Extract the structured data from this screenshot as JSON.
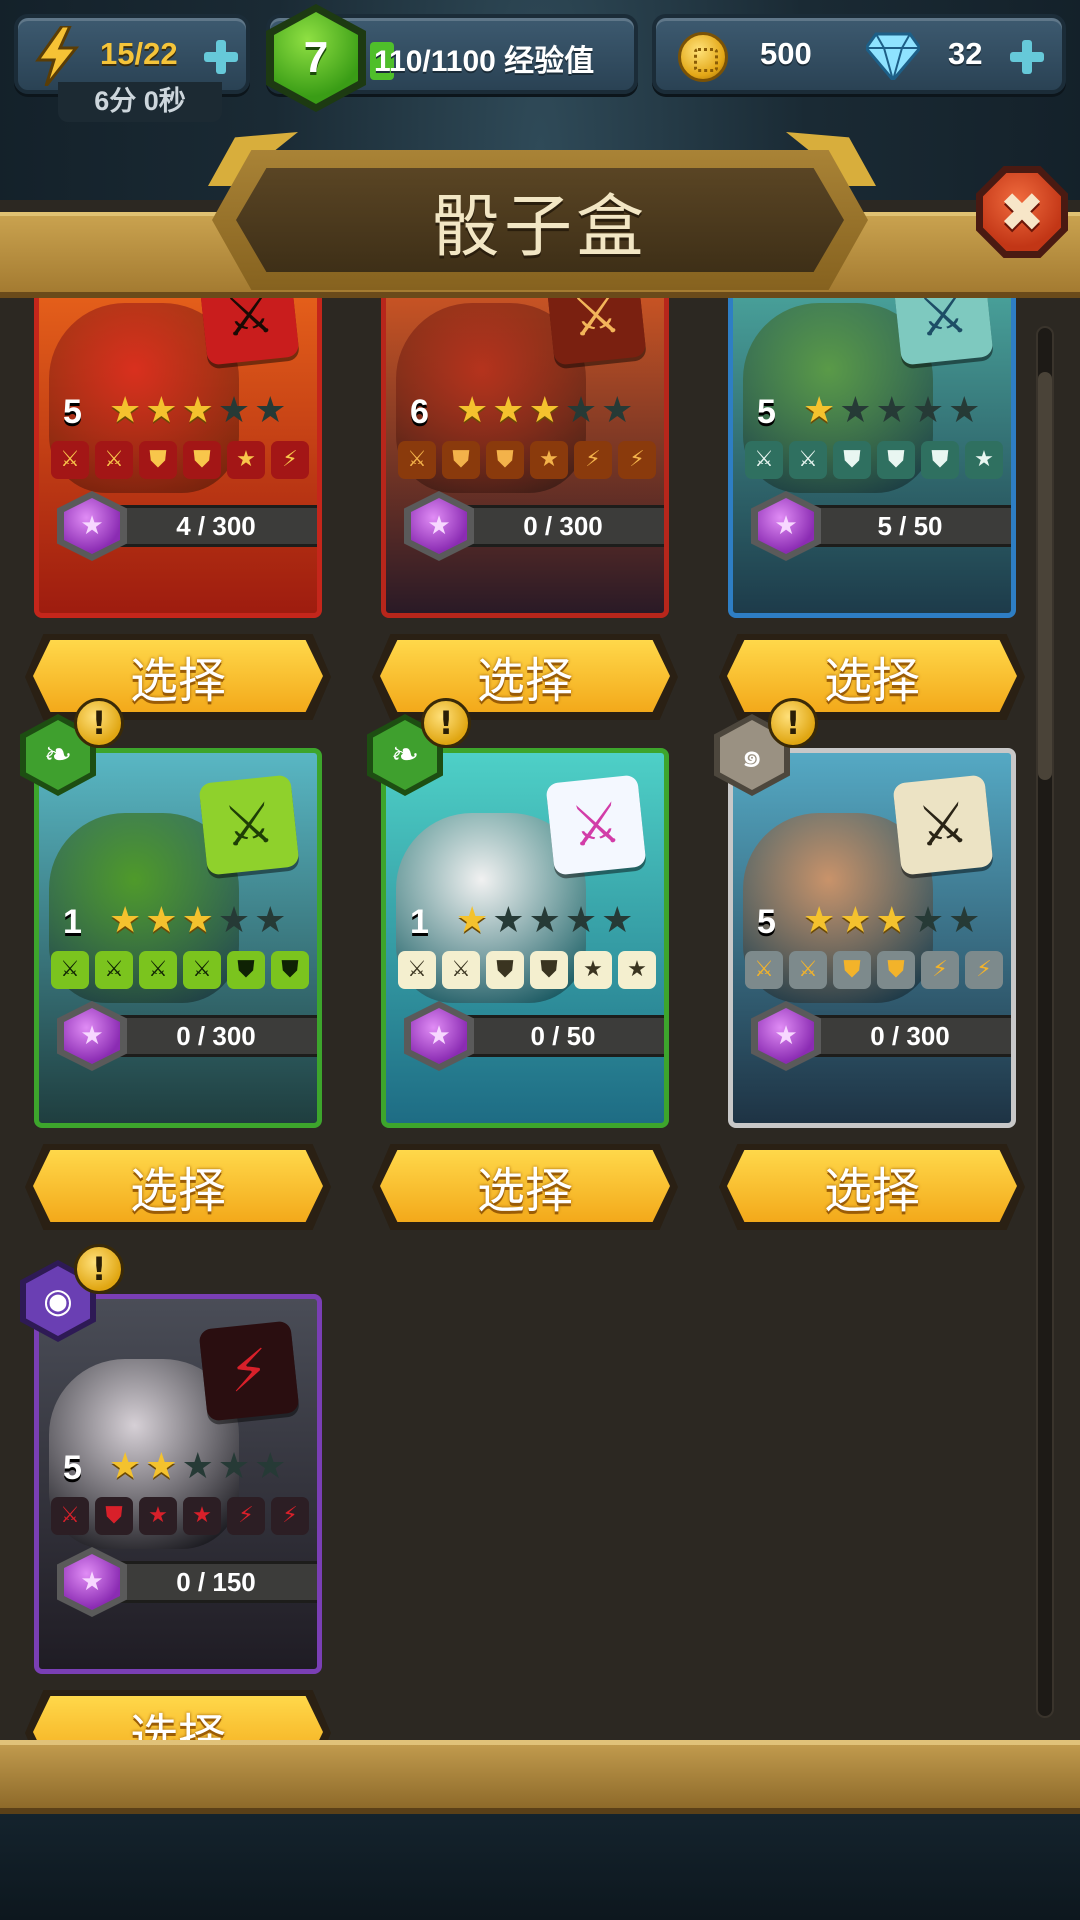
{
  "hud": {
    "energy": {
      "value": "15/22",
      "timer": "6分 0秒",
      "icon": "lightning-bolt-icon"
    },
    "level": {
      "number": "7",
      "xp_text": "110/1100 经验值",
      "xp_progress": 0.1
    },
    "currency": {
      "coins": "500",
      "gems": "32"
    }
  },
  "dialog": {
    "title": "骰子盒",
    "close_symbol": "✖"
  },
  "cards": [
    {
      "name": "red-dragon",
      "level": "5",
      "stars": 3,
      "max_stars": 5,
      "progress": "4 / 300",
      "border": "#c4261b",
      "bg": [
        "#f06a1c",
        "#9e1c0f"
      ],
      "creature": "#d9301e",
      "dice_bg": "#c91d1d",
      "dice_fg": "#1a0a04",
      "dice_symbol": "⚔",
      "faces": [
        [
          "sword",
          "#a31616",
          "#f8c64b"
        ],
        [
          "sword",
          "#a31616",
          "#f8c64b"
        ],
        [
          "shield",
          "#a31616",
          "#f8c64b"
        ],
        [
          "shield",
          "#a31616",
          "#f8c64b"
        ],
        [
          "star",
          "#a31616",
          "#f8c64b"
        ],
        [
          "bolt",
          "#a31616",
          "#f8c64b"
        ]
      ],
      "badge": null,
      "select_label": "选择"
    },
    {
      "name": "lava-golem",
      "level": "6",
      "stars": 3,
      "max_stars": 5,
      "progress": "0 / 300",
      "border": "#b7261b",
      "bg": [
        "#e25d24",
        "#2a1a26"
      ],
      "creature": "#b5331d",
      "dice_bg": "#7a2010",
      "dice_fg": "#f3b55a",
      "dice_symbol": "⚔",
      "faces": [
        [
          "sword",
          "#8a3a0c",
          "#f3b24a"
        ],
        [
          "shield",
          "#8a3a0c",
          "#f3b24a"
        ],
        [
          "shield",
          "#8a3a0c",
          "#f3b24a"
        ],
        [
          "star",
          "#8a3a0c",
          "#f3b24a"
        ],
        [
          "bolt",
          "#8a3a0c",
          "#f3b24a"
        ],
        [
          "bolt",
          "#8a3a0c",
          "#f3b24a"
        ]
      ],
      "badge": null,
      "select_label": "选择"
    },
    {
      "name": "frog-beast",
      "level": "5",
      "stars": 1,
      "max_stars": 5,
      "progress": "5 / 50",
      "border": "#2e7ec4",
      "bg": [
        "#4fb0a6",
        "#1d3b4a"
      ],
      "creature": "#5a9a48",
      "dice_bg": "#7ec9bf",
      "dice_fg": "#1d4e66",
      "dice_symbol": "⚔",
      "faces": [
        [
          "sword",
          "#2f7060",
          "#e9f6f1"
        ],
        [
          "sword",
          "#2f7060",
          "#e9f6f1"
        ],
        [
          "shield",
          "#2f7060",
          "#e9f6f1"
        ],
        [
          "shield",
          "#2f7060",
          "#e9f6f1"
        ],
        [
          "shield",
          "#2f7060",
          "#e9f6f1"
        ],
        [
          "star",
          "#2f7060",
          "#e9f6f1"
        ]
      ],
      "badge": null,
      "select_label": "选择"
    },
    {
      "name": "orc-warrior",
      "level": "1",
      "stars": 3,
      "max_stars": 5,
      "progress": "0 / 300",
      "border": "#3da52c",
      "bg": [
        "#59b7c4",
        "#1f3e3f"
      ],
      "creature": "#4f9a2a",
      "dice_bg": "#8fd12c",
      "dice_fg": "#1e3e06",
      "dice_symbol": "⚔",
      "faces": [
        [
          "sword",
          "#7bc41e",
          "#0f2204"
        ],
        [
          "sword",
          "#7bc41e",
          "#0f2204"
        ],
        [
          "sword",
          "#7bc41e",
          "#0f2204"
        ],
        [
          "sword",
          "#7bc41e",
          "#0f2204"
        ],
        [
          "shield",
          "#7bc41e",
          "#0f2204"
        ],
        [
          "shield",
          "#7bc41e",
          "#0f2204"
        ]
      ],
      "badge": {
        "color": "#3fa02e",
        "dark": "#1d4e12",
        "symbol": "❧"
      },
      "alert": "!",
      "select_label": "选择"
    },
    {
      "name": "unicorn",
      "level": "1",
      "stars": 1,
      "max_stars": 5,
      "progress": "0 / 50",
      "border": "#3da52c",
      "bg": [
        "#4ed0c7",
        "#1e6c84"
      ],
      "creature": "#f1f1f1",
      "dice_bg": "#f4f8ff",
      "dice_fg": "#d23da8",
      "dice_symbol": "⚔",
      "faces": [
        [
          "sword",
          "#f4efcf",
          "#3a3420"
        ],
        [
          "sword",
          "#f4efcf",
          "#3a3420"
        ],
        [
          "shield",
          "#f4efcf",
          "#3a3420"
        ],
        [
          "shield",
          "#f4efcf",
          "#3a3420"
        ],
        [
          "star",
          "#f4efcf",
          "#3a3420"
        ],
        [
          "star",
          "#f4efcf",
          "#3a3420"
        ]
      ],
      "badge": {
        "color": "#3fa02e",
        "dark": "#1d4e12",
        "symbol": "❧"
      },
      "alert": "!",
      "select_label": "选择"
    },
    {
      "name": "old-wizard",
      "level": "5",
      "stars": 3,
      "max_stars": 5,
      "progress": "0 / 300",
      "border": "#c8c8c8",
      "bg": [
        "#55a9c4",
        "#1e3344"
      ],
      "creature": "#c9936a",
      "dice_bg": "#ece3c4",
      "dice_fg": "#2a2416",
      "dice_symbol": "⚔",
      "faces": [
        [
          "sword",
          "#7d8a8c",
          "#f3b32a"
        ],
        [
          "sword",
          "#7d8a8c",
          "#f3b32a"
        ],
        [
          "shield",
          "#7d8a8c",
          "#f3b32a"
        ],
        [
          "shield",
          "#7d8a8c",
          "#f3b32a"
        ],
        [
          "bolt",
          "#7d8a8c",
          "#f3b32a"
        ],
        [
          "bolt",
          "#7d8a8c",
          "#f3b32a"
        ]
      ],
      "badge": {
        "color": "#9a9182",
        "dark": "#4d473d",
        "symbol": "๑"
      },
      "alert": "!",
      "select_label": "选择"
    },
    {
      "name": "vampire-jester",
      "level": "5",
      "stars": 2,
      "max_stars": 5,
      "progress": "0 / 150",
      "border": "#7a3fb5",
      "bg": [
        "#4a4d57",
        "#1f1c24"
      ],
      "creature": "#d6d0d6",
      "dice_bg": "#2a0e10",
      "dice_fg": "#d8202a",
      "dice_symbol": "⚡",
      "faces": [
        [
          "sword",
          "#2c1e24",
          "#d8202a"
        ],
        [
          "shield",
          "#2c1e24",
          "#d8202a"
        ],
        [
          "star",
          "#2c1e24",
          "#d8202a"
        ],
        [
          "star",
          "#2c1e24",
          "#d8202a"
        ],
        [
          "bolt",
          "#2c1e24",
          "#d8202a"
        ],
        [
          "bolt",
          "#2c1e24",
          "#d8202a"
        ]
      ],
      "badge": {
        "color": "#6a3fb3",
        "dark": "#2e1a55",
        "symbol": "◉"
      },
      "alert": "!",
      "select_label": "选择"
    }
  ],
  "icons": {
    "sword": "⚔",
    "shield": "⛊",
    "star": "★",
    "bolt": "⚡",
    "gem": "★"
  }
}
